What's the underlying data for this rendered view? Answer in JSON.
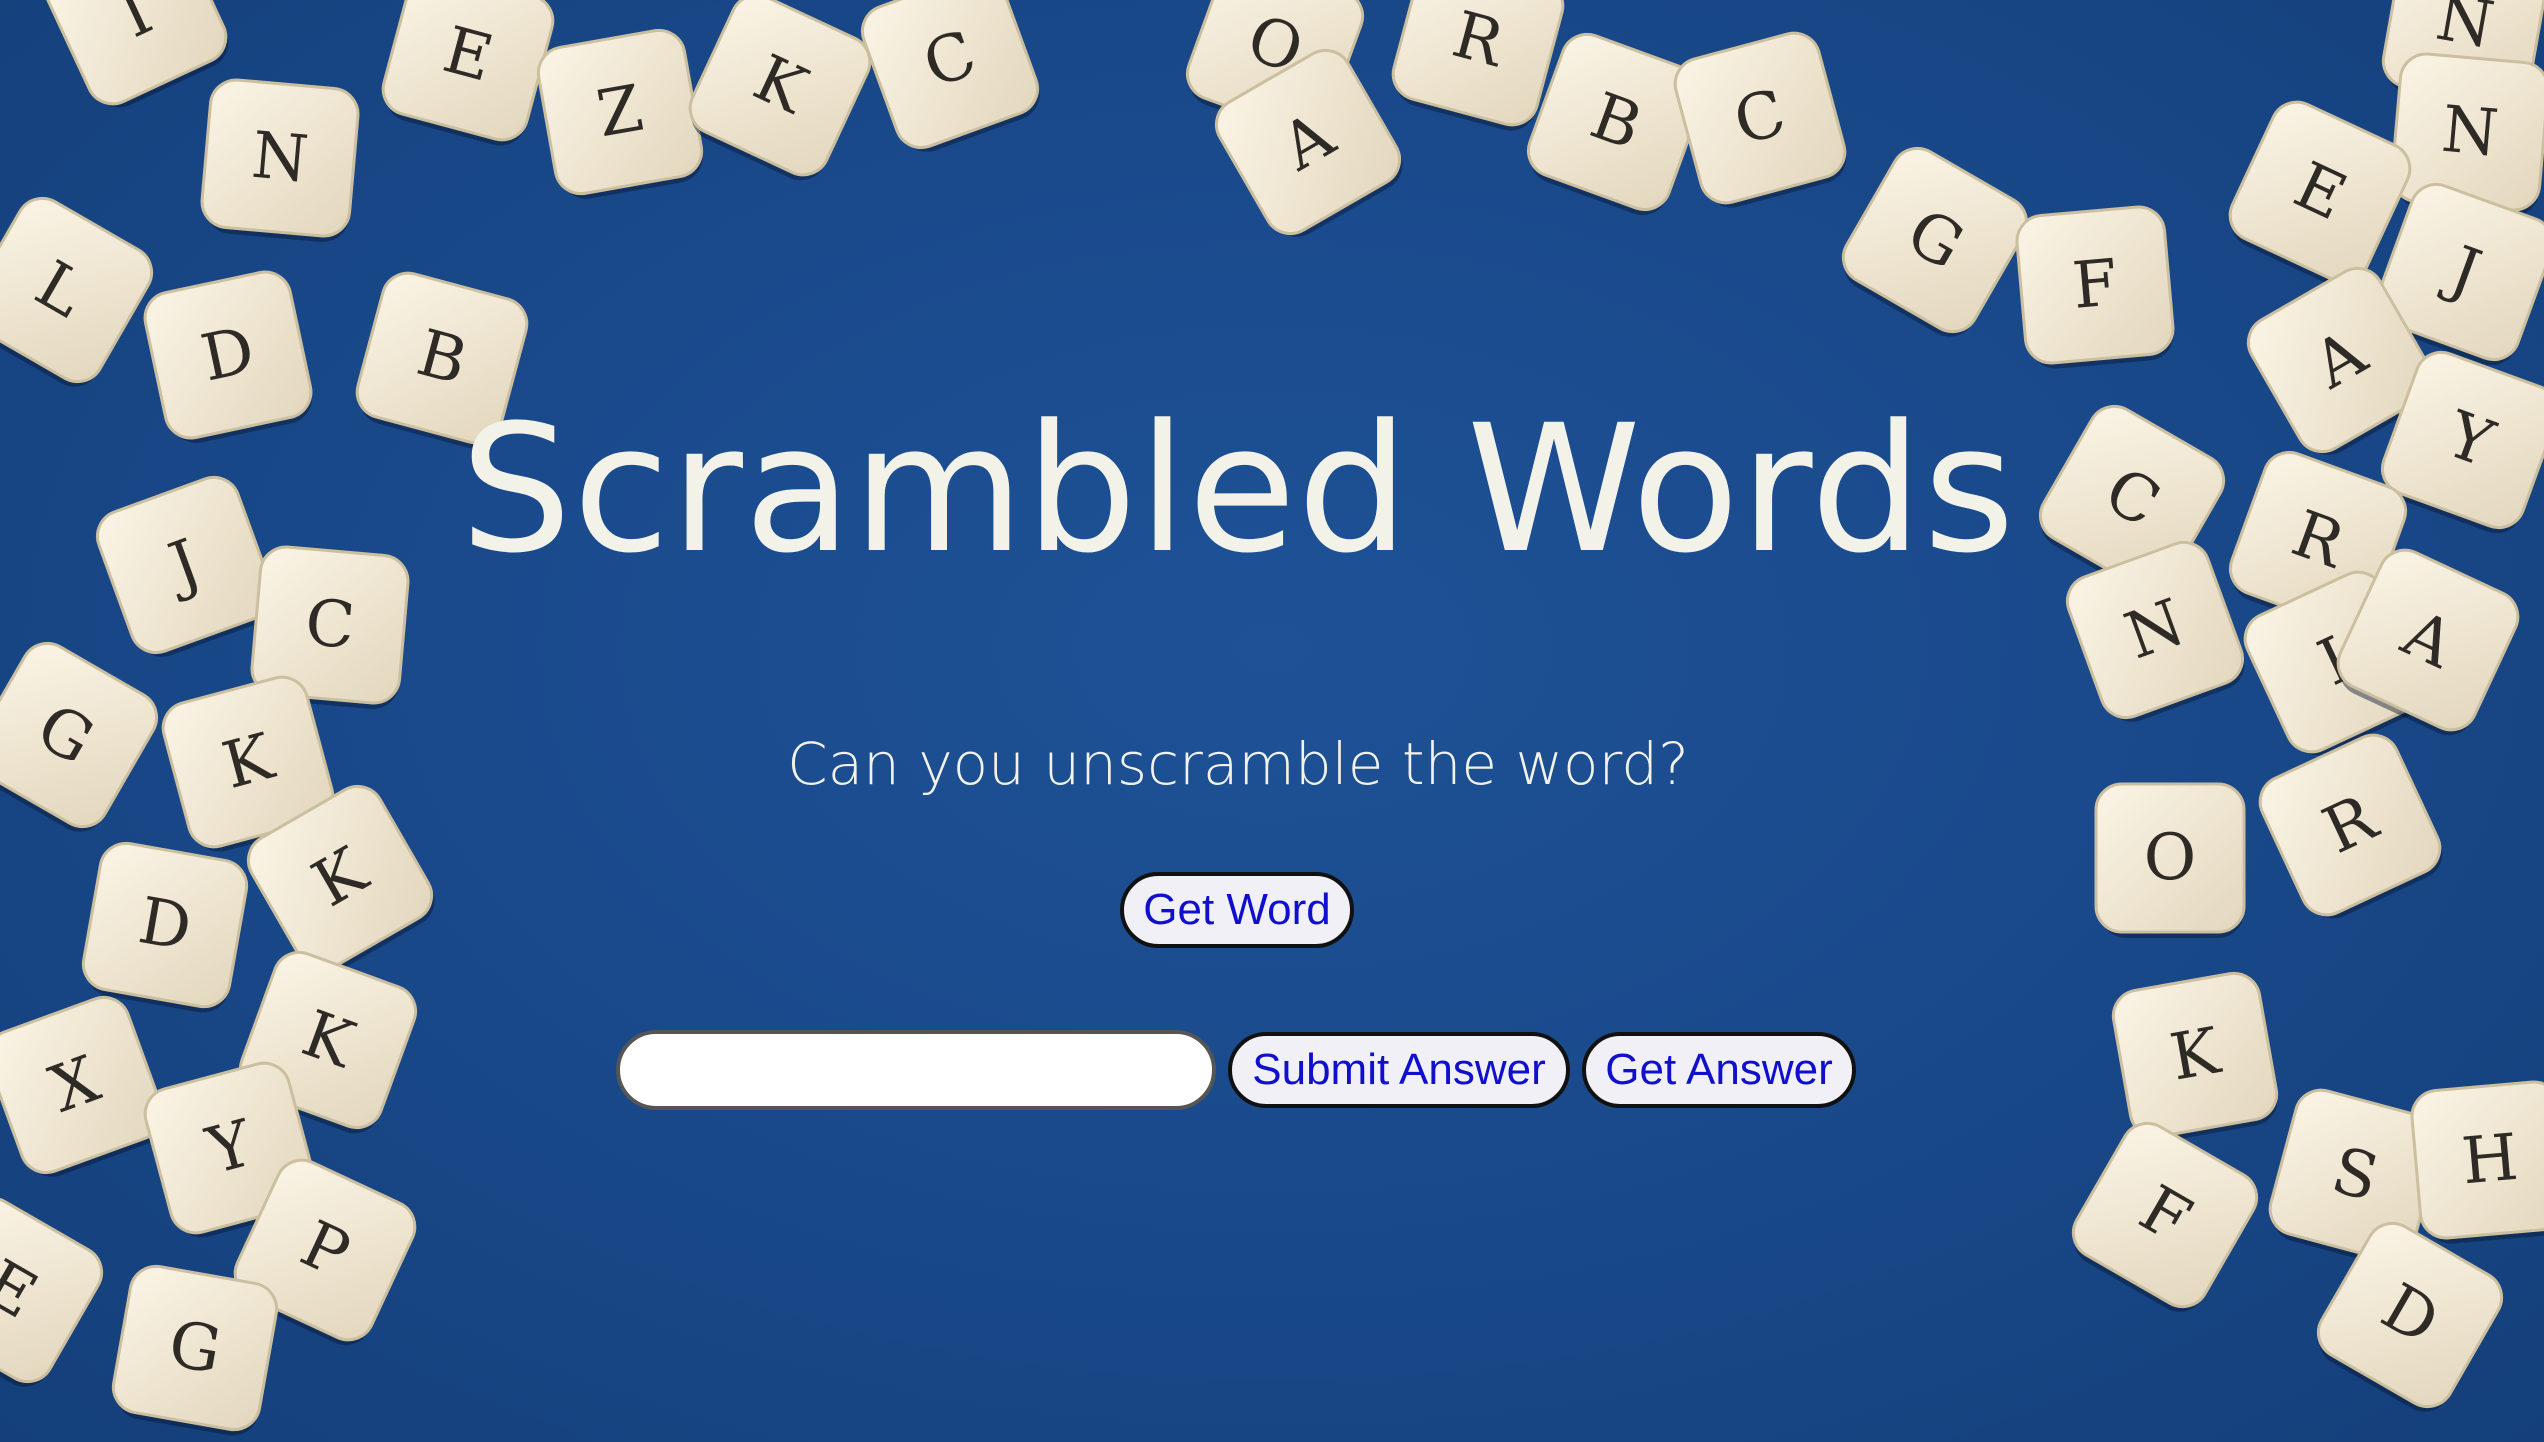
{
  "app": {
    "title": "Scrambled Words",
    "subtitle": "Can you unscramble the word?"
  },
  "controls": {
    "get_word_label": "Get Word",
    "answer_value": "",
    "answer_placeholder": "",
    "submit_label": "Submit Answer",
    "get_answer_label": "Get Answer"
  },
  "colors": {
    "background": "#1a4a8c",
    "heading_text": "#f2f2e8",
    "button_text": "#1010cc",
    "button_fill": "#f1f0f7",
    "die_face": "#f3ead7"
  },
  "background_dice_letters": [
    "I",
    "E",
    "Z",
    "K",
    "C",
    "N",
    "O",
    "A",
    "R",
    "B",
    "C",
    "N",
    "N",
    "L",
    "D",
    "B",
    "G",
    "F",
    "E",
    "J",
    "J",
    "C",
    "G",
    "K",
    "A",
    "Y",
    "C",
    "N",
    "R",
    "I",
    "A",
    "D",
    "K",
    "X",
    "K",
    "Y",
    "P",
    "G",
    "O",
    "R",
    "K",
    "S",
    "F",
    "H",
    "D",
    "E"
  ]
}
